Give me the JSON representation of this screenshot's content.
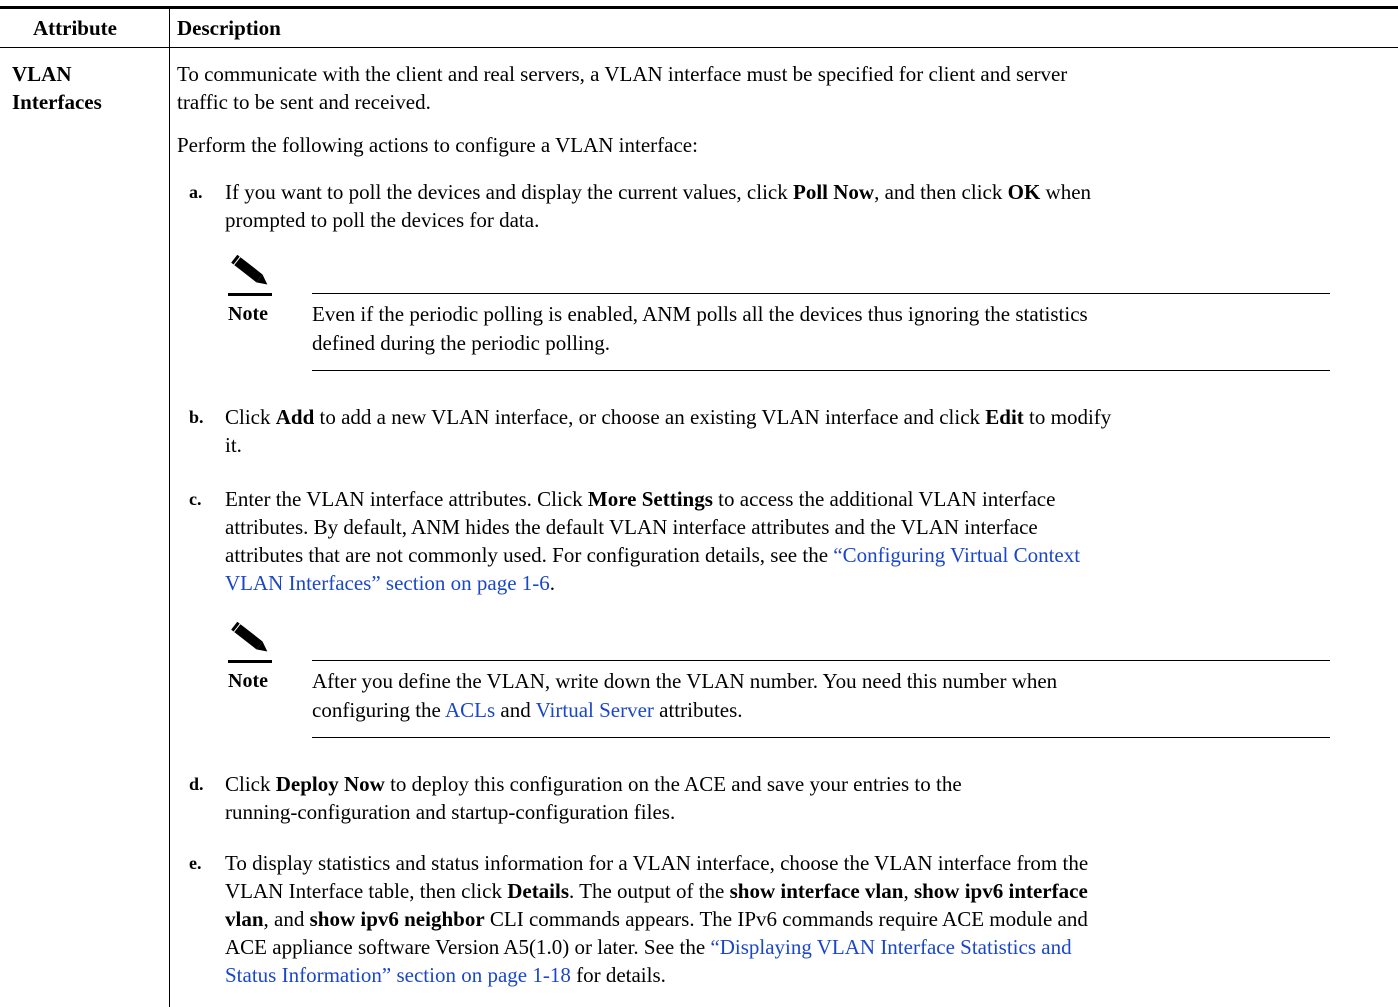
{
  "table": {
    "header": {
      "attribute": "Attribute",
      "description": "Description"
    },
    "row": {
      "attribute_line1": "VLAN",
      "attribute_line2": "Interfaces",
      "intro_line1": "To communicate with the client and real servers, a VLAN interface must be specified for client and server",
      "intro_line2": "traffic to be sent and received.",
      "perform": "Perform the following actions to configure a VLAN interface:",
      "steps": [
        {
          "letter": "a.",
          "l1_a": "If you want to poll the devices and display the current values, click ",
          "l1_b": "Poll Now",
          "l1_c": ", and then click ",
          "l1_d": "OK",
          "l1_e": " when",
          "l2": "prompted to poll the devices for data."
        },
        {
          "letter": "b.",
          "l1_a": "Click ",
          "l1_b": "Add",
          "l1_c": " to add a new VLAN interface, or choose an existing VLAN interface and click ",
          "l1_d": "Edit",
          "l1_e": " to modify",
          "l2": "it."
        },
        {
          "letter": "c.",
          "l1_a": "Enter the VLAN interface attributes. Click ",
          "l1_b": "More Settings",
          "l1_c": " to access the additional VLAN interface",
          "l2": "attributes. By default, ANM hides the default VLAN interface attributes and the VLAN interface",
          "l3_a": "attributes that are not commonly used. For configuration details, see the ",
          "l3_link": "“Configuring Virtual Context",
          "l4_link": "VLAN Interfaces” section on page 1-6",
          "l4_end": "."
        },
        {
          "letter": "d.",
          "l1_a": "Click ",
          "l1_b": "Deploy Now",
          "l1_c": " to deploy this configuration on the ACE and save your entries to the",
          "l2": "running-configuration and startup-configuration files."
        },
        {
          "letter": "e.",
          "l1": "To display statistics and status information for a VLAN interface, choose the VLAN interface from the",
          "l2_a": "VLAN Interface table, then click ",
          "l2_b": "Details",
          "l2_c": ". The output of the ",
          "l2_d": "show interface vlan",
          "l2_e": ", ",
          "l2_f": "show ipv6 interface",
          "l3_a": "vlan",
          "l3_b": ", and ",
          "l3_c": "show ipv6 neighbor",
          "l3_d": " CLI commands appears. The IPv6 commands require ACE module and",
          "l4_a": "ACE appliance software Version A5(1.0) or later. See the ",
          "l4_link": "“Displaying VLAN Interface Statistics and",
          "l5_link": "Status Information” section on page 1-18",
          "l5_end": " for details."
        }
      ],
      "notes": [
        {
          "label": "Note",
          "l1": "Even if the periodic polling is enabled, ANM polls all the devices thus ignoring the statistics",
          "l2": "defined during the periodic polling."
        },
        {
          "label": "Note",
          "l1": "After you define the VLAN, write down the VLAN number. You need this number when",
          "l2_a": "configuring the ",
          "l2_link1": "ACLs",
          "l2_b": " and ",
          "l2_link2": "Virtual Server",
          "l2_c": " attributes."
        }
      ]
    }
  },
  "colors": {
    "link": "#1a47c8",
    "text": "#000000"
  },
  "icons": {
    "note": "pencil-icon"
  }
}
